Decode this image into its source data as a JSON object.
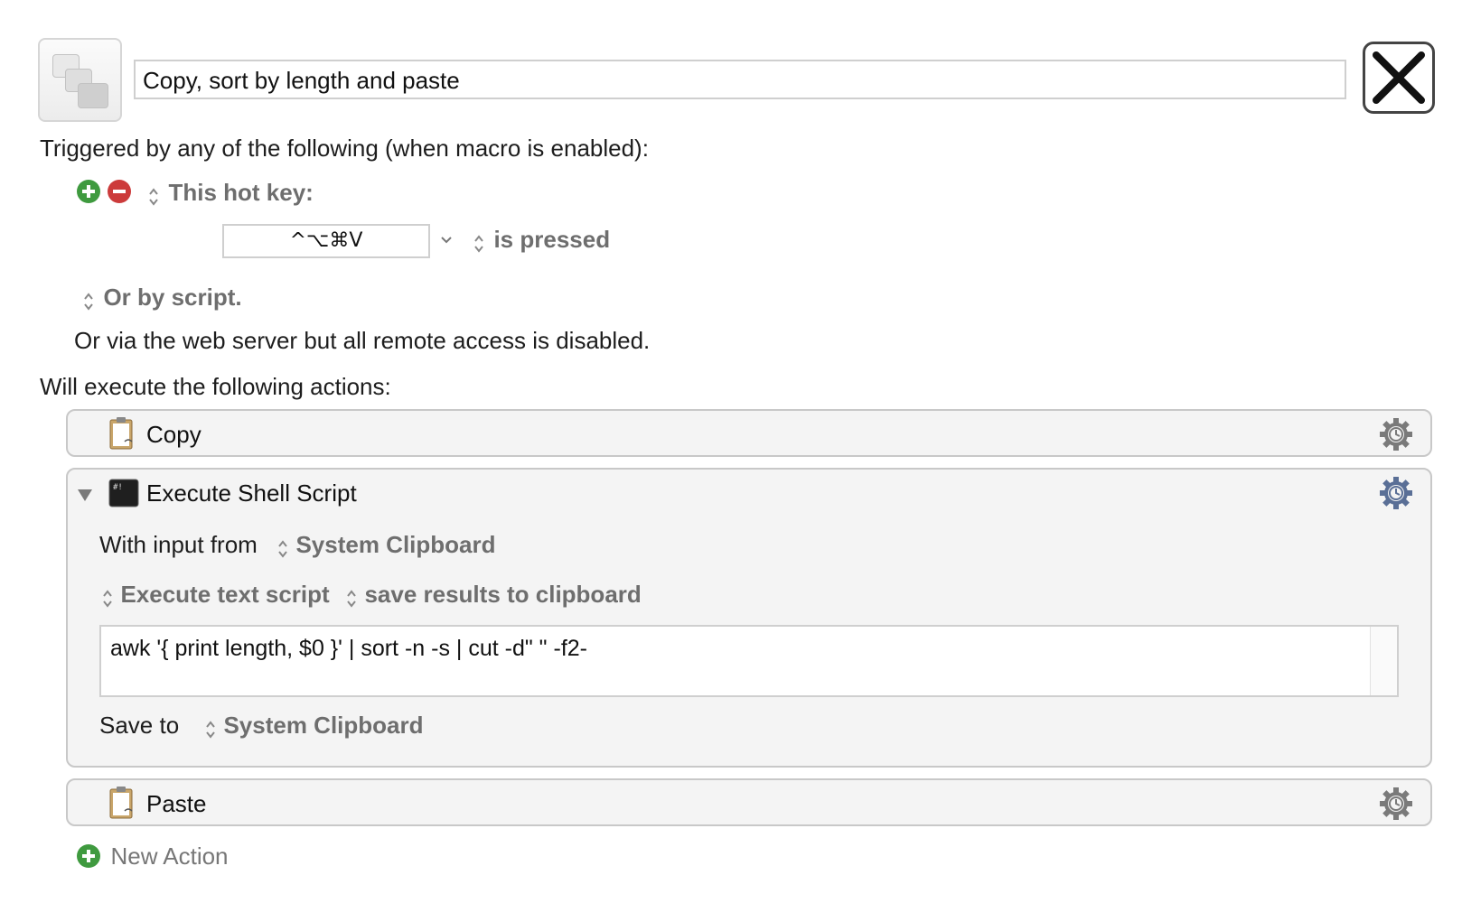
{
  "macro": {
    "name": "Copy, sort by length and paste"
  },
  "triggers": {
    "heading": "Triggered by any of the following (when macro is enabled):",
    "hotkey_type": "This hot key:",
    "hotkey_value": "^⌥⌘V",
    "hotkey_condition": "is pressed",
    "script_option": "Or by script.",
    "web_server": "Or via the web server but all remote access is disabled."
  },
  "actions_heading": "Will execute the following actions:",
  "actions": {
    "copy": {
      "label": "Copy"
    },
    "shell": {
      "label": "Execute Shell Script",
      "input_label": "With input from",
      "input_value": "System Clipboard",
      "mode": "Execute text script",
      "output_mode": "save results to clipboard",
      "script": "awk '{ print length, $0 }' | sort -n -s | cut -d\" \" -f2-",
      "save_label": "Save to",
      "save_value": "System Clipboard"
    },
    "paste": {
      "label": "Paste"
    }
  },
  "new_action": "New Action",
  "colors": {
    "add_green": "#3f9a3f",
    "remove_red": "#cc3b3b",
    "gear_blue": "#5a6f96"
  }
}
